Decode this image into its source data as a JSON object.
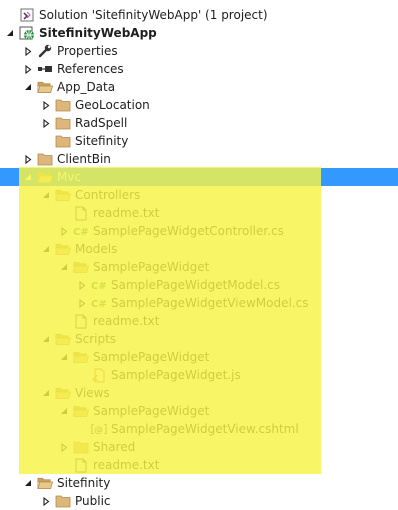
{
  "solution_explorer": {
    "highlight_color": "#f7f444",
    "selection_color": "#3399ff",
    "nodes": [
      {
        "label": "Solution 'SitefinityWebApp' (1 project)",
        "icon": "solution-icon",
        "caret": "none",
        "depth": 0
      },
      {
        "label": "SitefinityWebApp",
        "icon": "web-project-icon",
        "caret": "expanded",
        "depth": 0,
        "bold": true
      },
      {
        "label": "Properties",
        "icon": "wrench-icon",
        "caret": "collapsed",
        "depth": 1
      },
      {
        "label": "References",
        "icon": "references-icon",
        "caret": "collapsed",
        "depth": 1
      },
      {
        "label": "App_Data",
        "icon": "folder-open-icon",
        "caret": "expanded",
        "depth": 1
      },
      {
        "label": "GeoLocation",
        "icon": "folder-icon",
        "caret": "collapsed",
        "depth": 2
      },
      {
        "label": "RadSpell",
        "icon": "folder-icon",
        "caret": "collapsed",
        "depth": 2
      },
      {
        "label": "Sitefinity",
        "icon": "folder-icon",
        "caret": "none",
        "depth": 2
      },
      {
        "label": "ClientBin",
        "icon": "folder-icon",
        "caret": "collapsed",
        "depth": 1
      },
      {
        "label": "Mvc",
        "icon": "folder-open-icon",
        "caret": "expanded",
        "depth": 1,
        "selected": true
      },
      {
        "label": "Controllers",
        "icon": "folder-open-icon",
        "caret": "expanded",
        "depth": 2
      },
      {
        "label": "readme.txt",
        "icon": "text-file-icon",
        "caret": "none",
        "depth": 3
      },
      {
        "label": "SamplePageWidgetController.cs",
        "icon": "csharp-file-icon",
        "caret": "collapsed",
        "depth": 3
      },
      {
        "label": "Models",
        "icon": "folder-open-icon",
        "caret": "expanded",
        "depth": 2
      },
      {
        "label": "SamplePageWidget",
        "icon": "folder-open-icon",
        "caret": "expanded",
        "depth": 3
      },
      {
        "label": "SamplePageWidgetModel.cs",
        "icon": "csharp-file-icon",
        "caret": "collapsed",
        "depth": 4
      },
      {
        "label": "SamplePageWidgetViewModel.cs",
        "icon": "csharp-file-icon",
        "caret": "collapsed",
        "depth": 4
      },
      {
        "label": "readme.txt",
        "icon": "text-file-icon",
        "caret": "none",
        "depth": 3
      },
      {
        "label": "Scripts",
        "icon": "folder-open-icon",
        "caret": "expanded",
        "depth": 2
      },
      {
        "label": "SamplePageWidget",
        "icon": "folder-open-icon",
        "caret": "expanded",
        "depth": 3
      },
      {
        "label": "SamplePageWidget.js",
        "icon": "js-file-icon",
        "caret": "none",
        "depth": 4
      },
      {
        "label": "Views",
        "icon": "folder-open-icon",
        "caret": "expanded",
        "depth": 2
      },
      {
        "label": "SamplePageWidget",
        "icon": "folder-open-icon",
        "caret": "expanded",
        "depth": 3
      },
      {
        "label": "SamplePageWidgetView.cshtml",
        "icon": "razor-file-icon",
        "caret": "none",
        "depth": 4
      },
      {
        "label": "Shared",
        "icon": "folder-icon",
        "caret": "collapsed",
        "depth": 3
      },
      {
        "label": "readme.txt",
        "icon": "text-file-icon",
        "caret": "none",
        "depth": 3
      },
      {
        "label": "Sitefinity",
        "icon": "folder-open-icon",
        "caret": "expanded",
        "depth": 1
      },
      {
        "label": "Public",
        "icon": "folder-icon",
        "caret": "collapsed",
        "depth": 2
      }
    ]
  }
}
